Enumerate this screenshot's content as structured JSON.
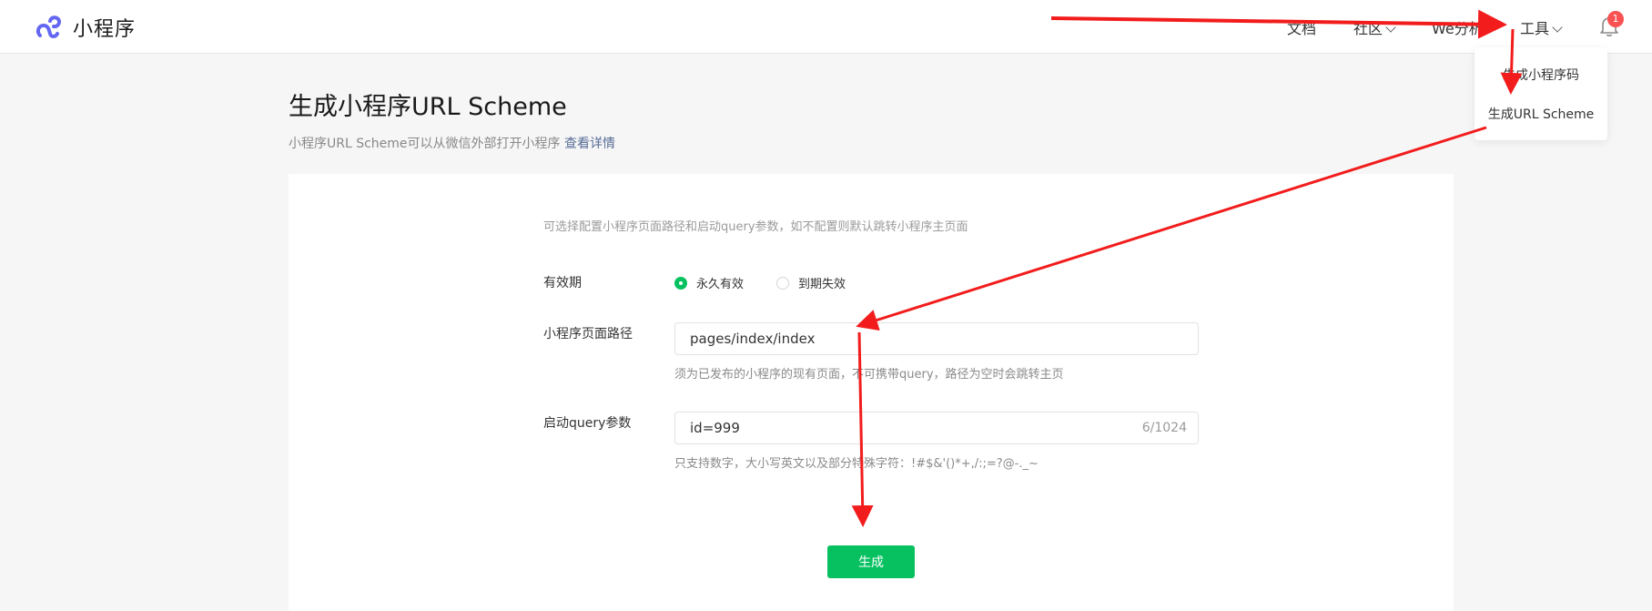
{
  "header": {
    "brand": "小程序",
    "nav": {
      "docs": "文档",
      "community": "社区",
      "we_analysis": "We分析",
      "tools": "工具"
    },
    "notification_count": "1"
  },
  "tools_menu": {
    "items": [
      "生成小程序码",
      "生成URL Scheme"
    ]
  },
  "page": {
    "title": "生成小程序URL Scheme",
    "description": "小程序URL Scheme可以从微信外部打开小程序",
    "details_link": "查看详情"
  },
  "form": {
    "tip": "可选择配置小程序页面路径和启动query参数，如不配置则默认跳转小程序主页面",
    "validity": {
      "label": "有效期",
      "options": [
        "永久有效",
        "到期失效"
      ],
      "selected": "永久有效"
    },
    "path": {
      "label": "小程序页面路径",
      "value": "pages/index/index",
      "hint": "须为已发布的小程序的现有页面，不可携带query，路径为空时会跳转主页"
    },
    "query": {
      "label": "启动query参数",
      "value": "id=999",
      "counter": "6/1024",
      "hint": "只支持数字，大小写英文以及部分特殊字符：!#$&'()*+,/:;=?@-._~"
    },
    "submit_label": "生成"
  },
  "colors": {
    "accent": "#07c160",
    "link": "#576b95",
    "badge": "#fa5151",
    "annotation_arrow": "#f21c1c",
    "logo": "#6467f0"
  }
}
